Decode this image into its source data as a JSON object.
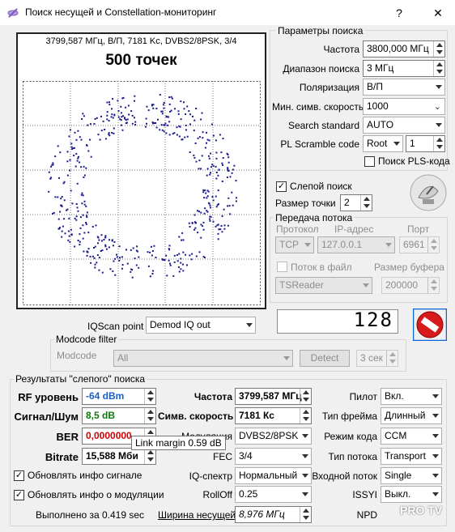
{
  "window": {
    "title": "Поиск несущей и Constellation-мониторинг",
    "help_btn": "?",
    "close_btn": "✕"
  },
  "constellation": {
    "info": "3799,587 МГц, В/П, 7181 Kc, DVBS2/8PSK, 3/4",
    "points": "500 точек"
  },
  "search_params": {
    "title": "Параметры поиска",
    "freq_label": "Частота",
    "freq_value": "3800,000 МГц",
    "range_label": "Диапазон поиска",
    "range_value": "3 МГц",
    "pol_label": "Поляризация",
    "pol_value": "В/П",
    "minsr_label": "Мин. симв. скорость",
    "minsr_value": "1000",
    "std_label": "Search standard",
    "std_value": "AUTO",
    "pls_label": "PL Scramble code",
    "pls_mode": "Root",
    "pls_value": "1",
    "pls_search_label": "Поиск PLS-кода"
  },
  "blind": {
    "label": "Слепой поиск",
    "dotsize_label": "Размер точки",
    "dotsize_value": "2"
  },
  "stream": {
    "title": "Передача потока",
    "proto_label": "Протокол",
    "ip_label": "IP-адрес",
    "port_label": "Порт",
    "proto_value": "TCP",
    "ip_value": "127.0.0.1",
    "port_value": "6961",
    "tofile_label": "Поток в файл",
    "buffer_label": "Размер буфера",
    "reader_value": "TSReader",
    "buffer_value": "200000"
  },
  "display_value": "128",
  "iqscan": {
    "label": "IQScan point",
    "value": "Demod IQ out"
  },
  "modcode": {
    "title": "Modcode filter",
    "label": "Modcode",
    "value": "All",
    "detect": "Detect",
    "time": "3 сек"
  },
  "results": {
    "title": "Результаты \"слепого\" поиска",
    "rf_label": "RF уровень",
    "rf_value": "-64 dBm",
    "snr_label": "Сигнал/Шум",
    "snr_value": "8,5 dB",
    "ber_label": "BER",
    "ber_value": "0,0000000",
    "bitrate_label": "Bitrate",
    "bitrate_value": "15,588 Мби",
    "tooltip": "Link margin 0.59 dB",
    "freq_label": "Частота",
    "freq_value": "3799,587 МГц",
    "sr_label": "Симв. скорость",
    "sr_value": "7181 Кс",
    "mod_label": "Модуляция",
    "mod_value": "DVBS2/8PSK",
    "fec_label": "FEC",
    "fec_value": "3/4",
    "iq_label": "IQ-спектр",
    "iq_value": "Нормальный",
    "rolloff_label": "RollOff",
    "rolloff_value": "0.25",
    "bw_label": "Ширина несущей",
    "bw_value": "8,976 МГц",
    "pilot_label": "Пилот",
    "pilot_value": "Вкл.",
    "frame_label": "Тип фрейма",
    "frame_value": "Длинный",
    "code_label": "Режим кода",
    "code_value": "CCM",
    "flow_label": "Тип потока",
    "flow_value": "Transport",
    "input_label": "Входной поток",
    "input_value": "Single",
    "issyi_label": "ISSYI",
    "issyi_value": "Выкл.",
    "npd_label": "NPD",
    "upd_signal": "Обновлять инфо сигнале",
    "upd_mod": "Обновлять инфо о модуляции",
    "elapsed": "Выполнено за 0.419 sec"
  },
  "watermark": "PRO TV",
  "colors": {
    "rf_value": "#1a5fd0",
    "snr_value": "#0a7a0a",
    "ber_value": "#d00000",
    "dots": "#1a1a8c"
  }
}
